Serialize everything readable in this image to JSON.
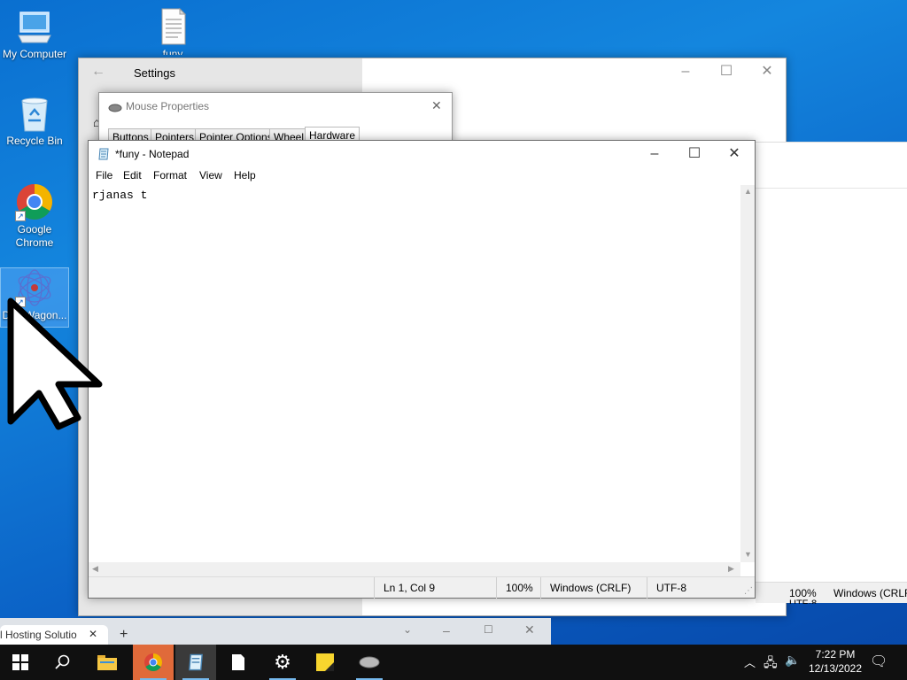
{
  "desktop": {
    "icons": [
      {
        "label": "My Computer"
      },
      {
        "label": "funy"
      },
      {
        "label": "Recycle Bin"
      },
      {
        "label": "Google Chrome"
      },
      {
        "label": "DataWagon..."
      }
    ]
  },
  "settings": {
    "title": "Settings"
  },
  "mouse_properties": {
    "title": "Mouse Properties",
    "tabs": [
      "Buttons",
      "Pointers",
      "Pointer Options",
      "Wheel",
      "Hardware"
    ]
  },
  "notepad": {
    "title": "*funy - Notepad",
    "menu": [
      "File",
      "Edit",
      "Format",
      "View",
      "Help"
    ],
    "content": "rjanas t",
    "status": {
      "position": "Ln 1, Col 9",
      "zoom": "100%",
      "line_ending": "Windows (CRLF)",
      "encoding": "UTF-8"
    }
  },
  "background_window_status": {
    "zoom": "100%",
    "line_ending": "Windows (CRLF",
    "encoding": "UTF-8"
  },
  "browser": {
    "tab_title": "l Hosting Solutio"
  },
  "taskbar": {
    "time": "7:22 PM",
    "date": "12/13/2022"
  }
}
